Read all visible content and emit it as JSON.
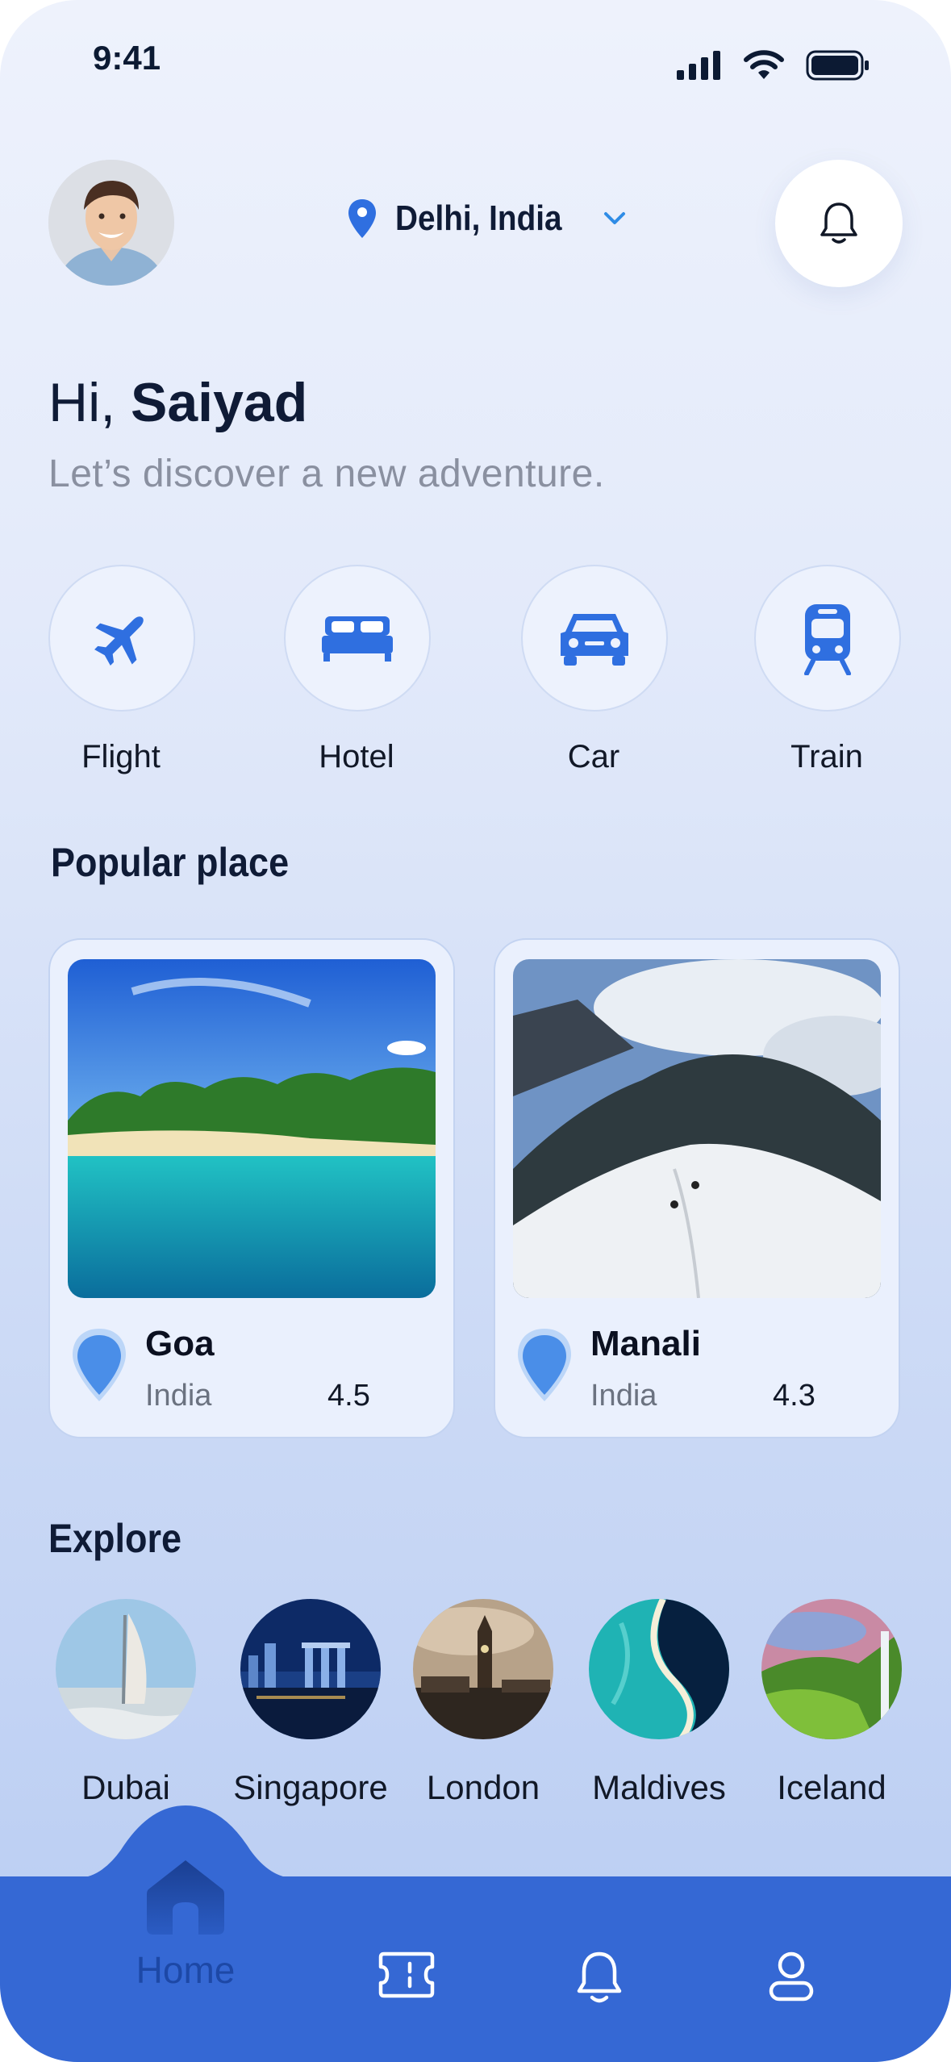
{
  "status_bar": {
    "time": "9:41"
  },
  "header": {
    "location": "Delhi, India",
    "icons": {
      "location": "location-pin-icon",
      "dropdown": "chevron-down-icon",
      "notification": "bell-icon"
    }
  },
  "greeting": {
    "prefix": "Hi, ",
    "name": "Saiyad",
    "subtitle": "Let’s discover a new adventure."
  },
  "categories": [
    {
      "label": "Flight",
      "icon": "airplane-icon"
    },
    {
      "label": "Hotel",
      "icon": "bed-icon"
    },
    {
      "label": "Car",
      "icon": "car-icon"
    },
    {
      "label": "Train",
      "icon": "train-icon"
    }
  ],
  "popular": {
    "title": "Popular place",
    "places": [
      {
        "name": "Goa",
        "country": "India",
        "rating": "4.5"
      },
      {
        "name": "Manali",
        "country": "India",
        "rating": "4.3"
      }
    ]
  },
  "explore": {
    "title": "Explore",
    "items": [
      {
        "label": "Dubai"
      },
      {
        "label": "Singapore"
      },
      {
        "label": "London"
      },
      {
        "label": "Maldives"
      },
      {
        "label": "Iceland"
      }
    ]
  },
  "nav": {
    "home_label": "Home",
    "items": [
      "home-icon",
      "ticket-icon",
      "bell-icon",
      "profile-icon"
    ]
  },
  "colors": {
    "primary": "#3568d4",
    "home_active": "#1d48a6",
    "accent_pin": "#2f6fe0"
  }
}
